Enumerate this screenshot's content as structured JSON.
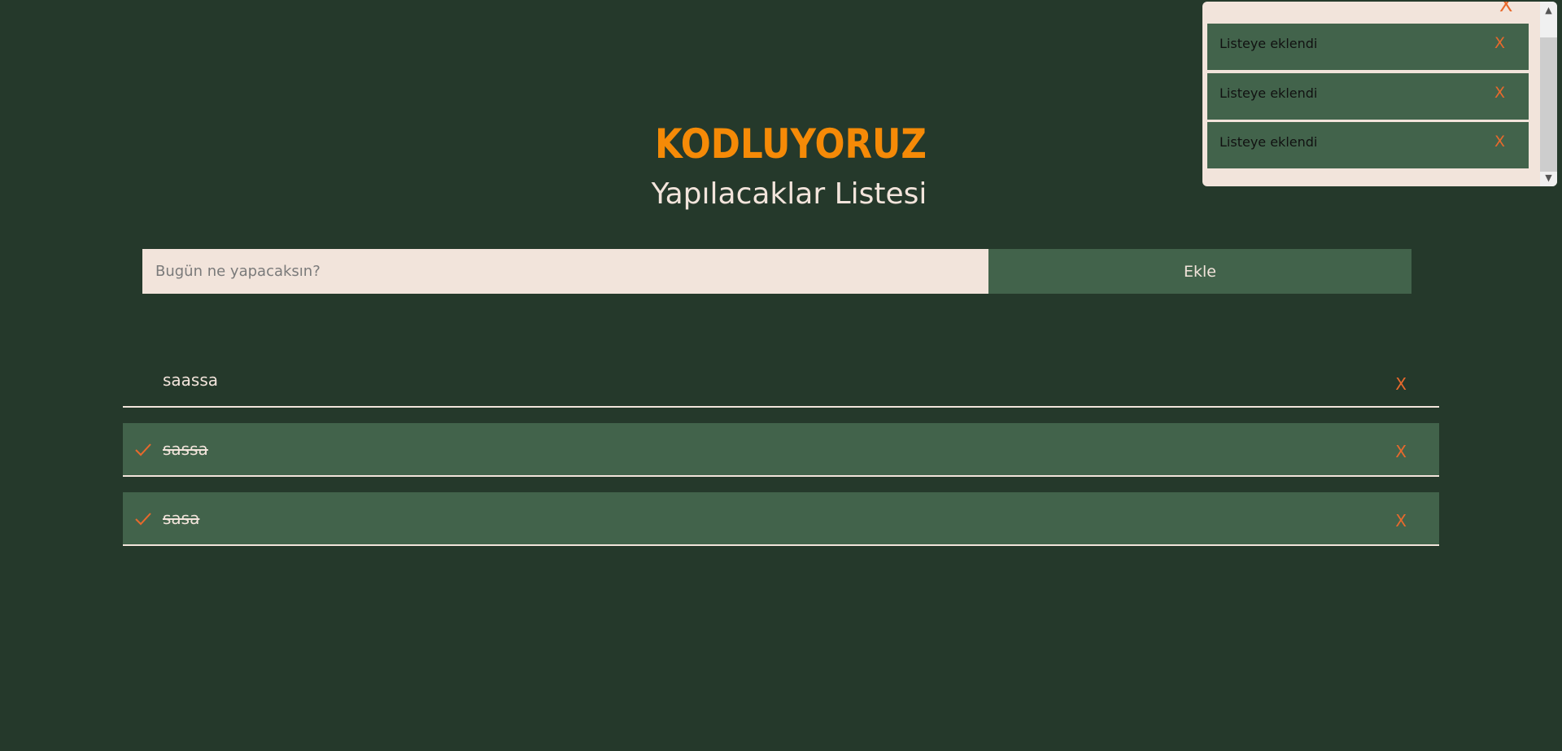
{
  "logo": {
    "text": "KODLUYORUZ",
    "color": "#f58a07"
  },
  "title": "Yapılacaklar Listesi",
  "form": {
    "input_value": "",
    "input_placeholder": "Bugün ne yapacaksın?",
    "add_label": "Ekle"
  },
  "todos": [
    {
      "text": "saassa",
      "done": false,
      "delete_label": "X"
    },
    {
      "text": "sassa",
      "done": true,
      "delete_label": "X"
    },
    {
      "text": "sasa",
      "done": true,
      "delete_label": "X"
    }
  ],
  "toast_panel": {
    "close_label": "X",
    "items": [
      {
        "text": "Listeye eklendi",
        "close_label": "X"
      },
      {
        "text": "Listeye eklendi",
        "close_label": "X"
      },
      {
        "text": "Listeye eklendi",
        "close_label": "X"
      }
    ]
  },
  "colors": {
    "background": "#25392b",
    "accent": "#e8692c",
    "item_done": "#42634b",
    "light": "#f2e4db"
  }
}
